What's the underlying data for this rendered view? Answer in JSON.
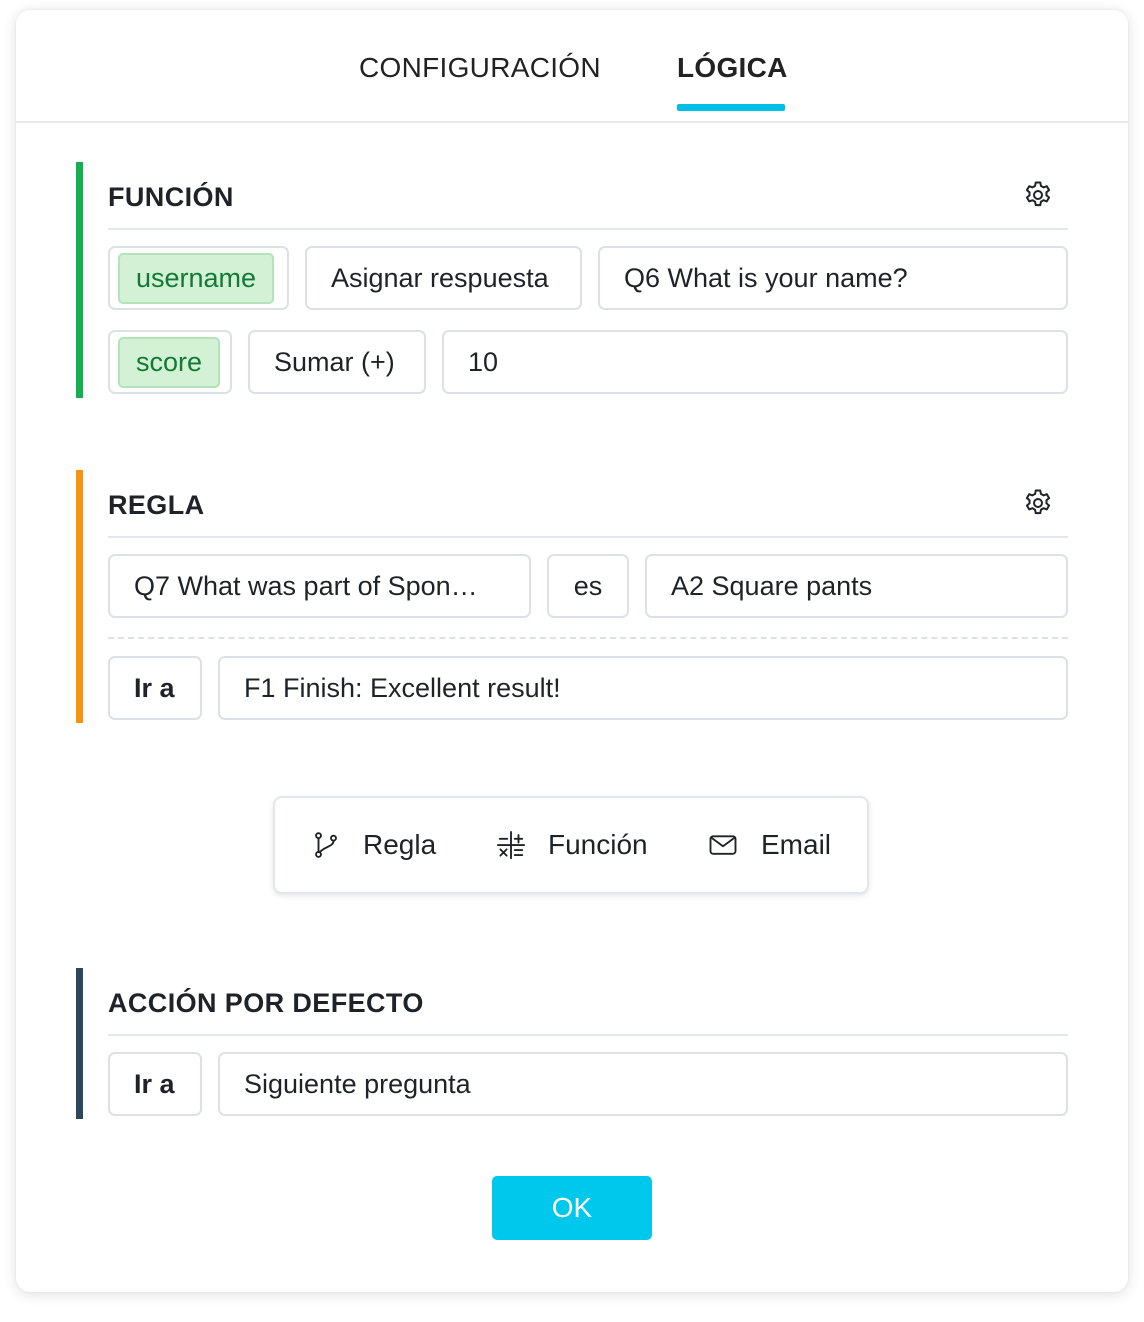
{
  "tabs": [
    {
      "label": "CONFIGURACIÓN",
      "active": false
    },
    {
      "label": "LÓGICA",
      "active": true
    }
  ],
  "colors": {
    "accent": "#00bfe6",
    "function_bar": "#12b04f",
    "rule_bar": "#f7940e",
    "default_bar": "#2c475c",
    "chip_bg": "#d2f1d5",
    "chip_text": "#127a35"
  },
  "function_section": {
    "title": "FUNCIÓN",
    "settings_icon": "gear-icon",
    "rows": [
      {
        "variable": "username",
        "operation": "Asignar respuesta",
        "value": "Q6 What is your name?"
      },
      {
        "variable": "score",
        "operation": "Sumar (+)",
        "value": "10"
      }
    ]
  },
  "rule_section": {
    "title": "REGLA",
    "settings_icon": "gear-icon",
    "condition": {
      "question": "Q7 What was part of Spon…",
      "operator": "es",
      "answer": "A2 Square pants"
    },
    "action": {
      "label": "Ir a",
      "target": "F1 Finish: Excellent result!"
    }
  },
  "add_bar": {
    "items": [
      {
        "label": "Regla",
        "icon": "branch-icon"
      },
      {
        "label": "Función",
        "icon": "calculator-icon"
      },
      {
        "label": "Email",
        "icon": "envelope-icon"
      }
    ]
  },
  "default_section": {
    "title": "ACCIÓN POR DEFECTO",
    "action": {
      "label": "Ir a",
      "target": "Siguiente pregunta"
    }
  },
  "ok_button": {
    "label": "OK"
  }
}
